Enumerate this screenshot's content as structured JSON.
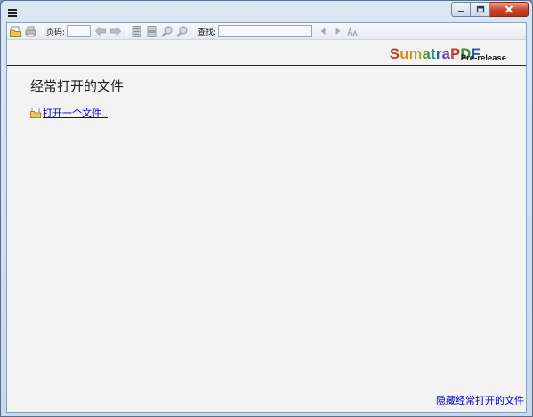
{
  "toolbar": {
    "page_label": "页码:",
    "page_value": "",
    "find_label": "查找:",
    "find_value": ""
  },
  "brand": {
    "letters": [
      {
        "ch": "S",
        "color": "#c0392b"
      },
      {
        "ch": "u",
        "color": "#e08a1e"
      },
      {
        "ch": "m",
        "color": "#c4a31a"
      },
      {
        "ch": "a",
        "color": "#3a8f2e"
      },
      {
        "ch": "t",
        "color": "#2b8a8a"
      },
      {
        "ch": "r",
        "color": "#2c5fa8"
      },
      {
        "ch": "a",
        "color": "#6a3a9a"
      },
      {
        "ch": "P",
        "color": "#c0392b"
      },
      {
        "ch": "D",
        "color": "#3a8f2e"
      },
      {
        "ch": "F",
        "color": "#2c5fa8"
      }
    ],
    "suffix": "Pre-release"
  },
  "home": {
    "frequent_title": "经常打开的文件",
    "open_file_link": "打开一个文件..",
    "hide_link": "隐藏经常打开的文件"
  },
  "colors": {
    "link": "#0000cc",
    "close_button": "#c7442a"
  }
}
